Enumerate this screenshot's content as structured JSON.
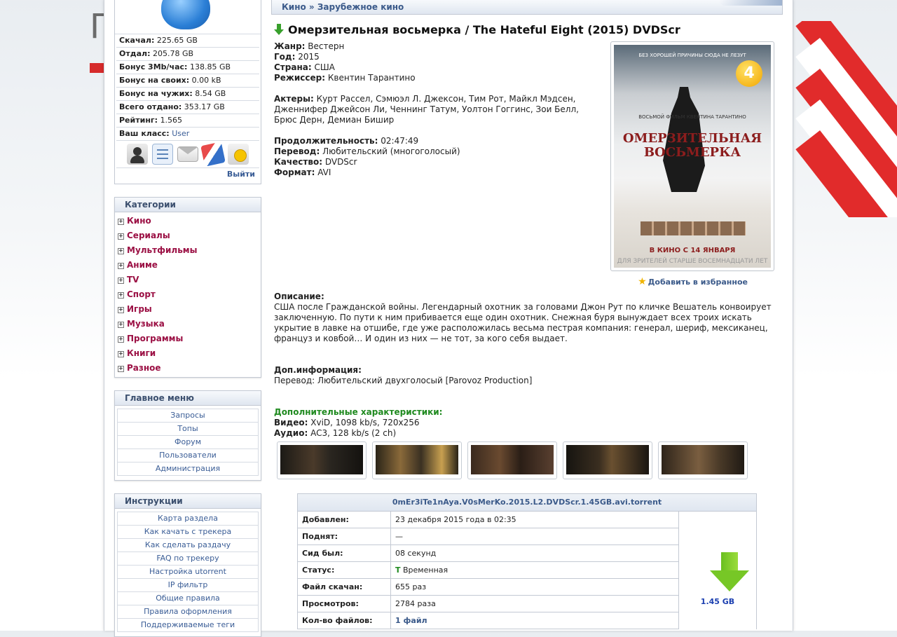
{
  "user": {
    "stats": [
      {
        "label": "Скачал:",
        "value": "225.65 GB"
      },
      {
        "label": "Отдал:",
        "value": "205.78 GB"
      },
      {
        "label": "Бонус 3Mb/час:",
        "value": "138.85 GB"
      },
      {
        "label": "Бонус на своих:",
        "value": "0.00 kB"
      },
      {
        "label": "Бонус на чужих:",
        "value": "8.54 GB"
      },
      {
        "label": "Всего отдано:",
        "value": "353.17 GB"
      },
      {
        "label": "Рейтинг:",
        "value": "1.565"
      },
      {
        "label": "Ваш класс:",
        "value": "User"
      }
    ],
    "icons": [
      "profile-icon",
      "settings-icon",
      "messages-icon",
      "bookmarks-icon",
      "smiley-icon"
    ],
    "logout_label": "Выйти"
  },
  "categories": {
    "title": "Категории",
    "items": [
      "Кино",
      "Сериалы",
      "Мультфильмы",
      "Аниме",
      "TV",
      "Спорт",
      "Игры",
      "Музыка",
      "Программы",
      "Книги",
      "Разное"
    ]
  },
  "main_menu": {
    "title": "Главное меню",
    "items": [
      "Запросы",
      "Топы",
      "Форум",
      "Пользователи",
      "Администрация"
    ]
  },
  "instructions": {
    "title": "Инструкции",
    "items": [
      "Карта раздела",
      "Как качать с трекера",
      "Как сделать раздачу",
      "FAQ по трекеру",
      "Настройка utorrent",
      "IP фильтр",
      "Общие правила",
      "Правила оформления",
      "Поддерживаемые теги"
    ]
  },
  "breadcrumb": "Кино » Зарубежное кино",
  "release": {
    "title": "Омерзительная восьмерка / The Hateful Eight (2015) DVDScr",
    "info": [
      {
        "label": "Жанр:",
        "value": "Вестерн"
      },
      {
        "label": "Год:",
        "value": "2015"
      },
      {
        "label": "Страна:",
        "value": "США"
      },
      {
        "label": "Режиссер:",
        "value": "Квентин Тарантино"
      }
    ],
    "actors_label": "Актеры:",
    "actors": "Курт Рассел, Сэмюэл Л. Джексон, Тим Рот, Майкл Мэдсен, Дженнифер Джейсон Ли, Ченнинг Татум, Уолтон Гоггинс, Зои Белл, Брюс Дерн, Демиан Бишир",
    "tech": [
      {
        "label": "Продолжительность:",
        "value": "02:47:49"
      },
      {
        "label": "Перевод:",
        "value": "Любительский (многоголосый)"
      },
      {
        "label": "Качество:",
        "value": "DVDScr"
      },
      {
        "label": "Формат:",
        "value": "AVI"
      }
    ],
    "poster": {
      "top_text": "БЕЗ ХОРОШЕЙ ПРИЧИНЫ СЮДА НЕ ЛЕЗУТ",
      "badge": "4",
      "subtitle": "ВОСЬМОЙ ФИЛЬМ КВЕНТИНА ТАРАНТИНО",
      "title_line1": "ОМЕРЗИТЕЛЬНАЯ",
      "title_line2": "ВОСЬМЕРКА",
      "release_text": "В КИНО С 14 ЯНВАРЯ",
      "age_text": "ДЛЯ ЗРИТЕЛЕЙ СТАРШЕ ВОСЕМНАДЦАТИ ЛЕТ"
    },
    "favorite_label": "Добавить в избранное",
    "description_label": "Описание:",
    "description": "США после Гражданской войны. Легендарный охотник за головами Джон Рут по кличке Вешатель конвоирует заключенную. По пути к ним прибивается еще один охотник. Снежная буря вынуждает всех троих искать укрытие в лавке на отшибе, где уже расположилась весьма пестрая компания: генерал, шериф, мексиканец, француз и ковбой… И один из них — не тот, за кого себя выдает.",
    "extra_label": "Доп.информация:",
    "extra": "Перевод: Любительский двухголосый [Parovoz Production]",
    "specs_label": "Дополнительные характеристики:",
    "specs": [
      {
        "label": "Видео:",
        "value": "XviD, 1098 kb/s, 720x256"
      },
      {
        "label": "Аудио:",
        "value": "AC3, 128 kb/s (2 ch)"
      }
    ]
  },
  "torrent": {
    "filename": "0mEr3iTe1nAya.V0sMerKo.2015.L2.DVDScr.1.45GB.avi.torrent",
    "rows": [
      {
        "label": "Добавлен:",
        "value": "23 декабря 2015 года в 02:35"
      },
      {
        "label": "Поднят:",
        "value": "—"
      },
      {
        "label": "Сид был:",
        "value": "08 секунд"
      },
      {
        "label": "Статус:",
        "mark": "T",
        "value": "Временная"
      },
      {
        "label": "Файл скачан:",
        "value": "655 раз"
      },
      {
        "label": "Просмотров:",
        "value": "2784 раза"
      },
      {
        "label": "Кол-во файлов:",
        "value": "1 файл"
      }
    ],
    "size": "1.45 GB"
  }
}
